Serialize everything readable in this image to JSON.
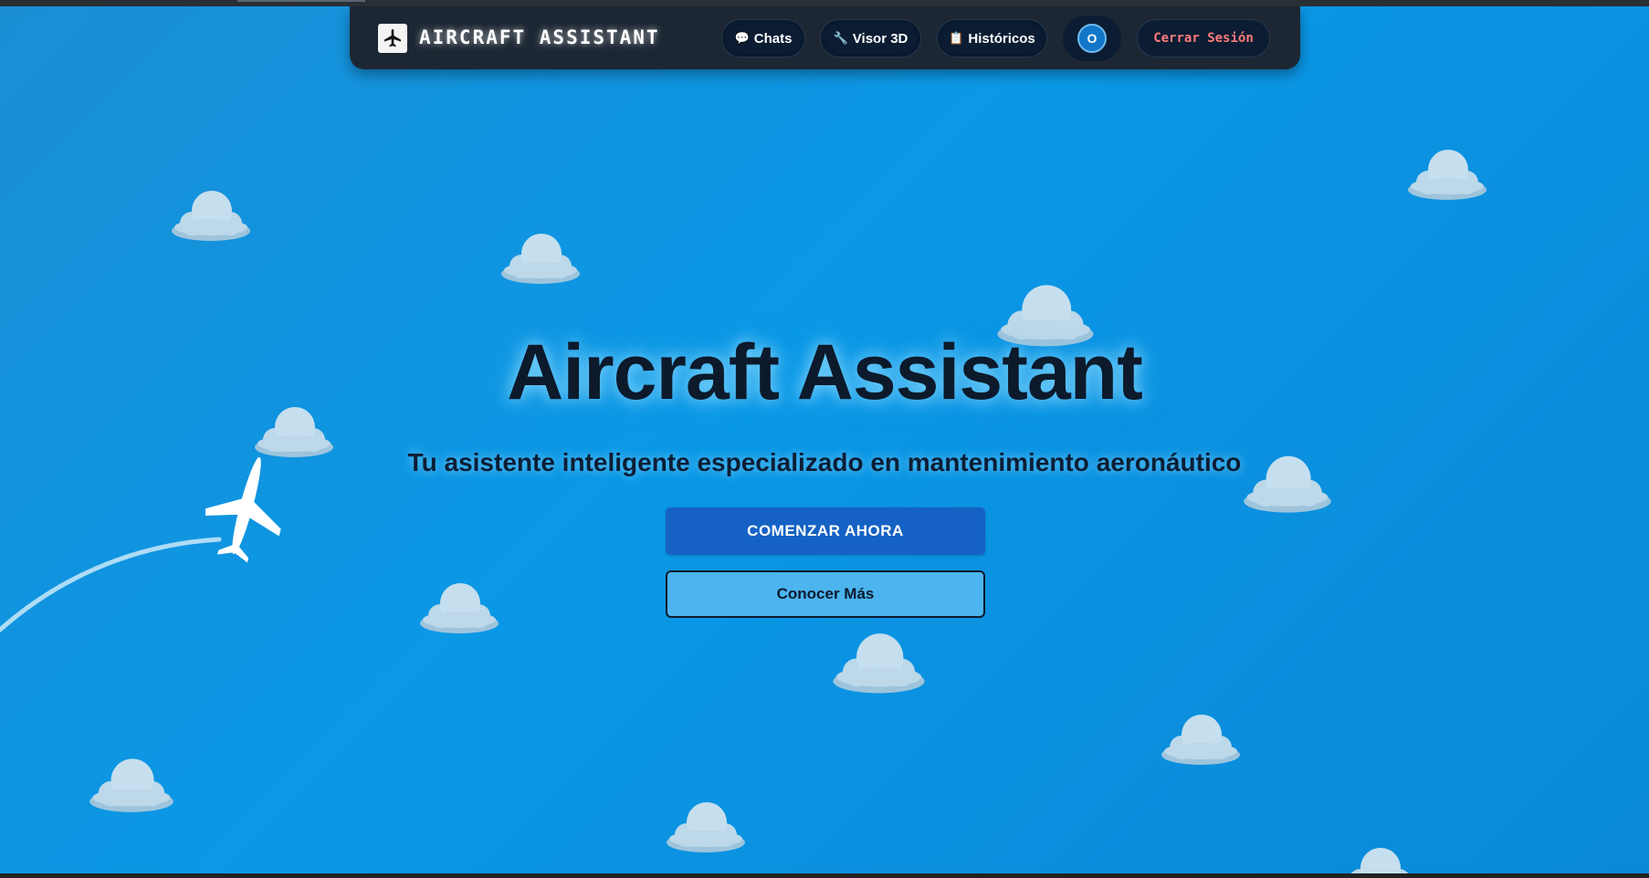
{
  "navbar": {
    "brand_title": "AIRCRAFT ASSISTANT",
    "logo_icon": "airplane-icon",
    "items": [
      {
        "icon": "💬",
        "icon_name": "chat-bubble-icon",
        "label": "Chats"
      },
      {
        "icon": "🔧",
        "icon_name": "wrench-icon",
        "label": "Visor 3D"
      },
      {
        "icon": "📋",
        "icon_name": "clipboard-icon",
        "label": "Históricos"
      }
    ],
    "avatar_initial": "O",
    "logout_label": "Cerrar Sesión"
  },
  "hero": {
    "title": "Aircraft Assistant",
    "subtitle": "Tu asistente inteligente especializado en mantenimiento aeronáutico",
    "primary_button": "COMENZAR AHORA",
    "secondary_button": "Conocer Más"
  },
  "colors": {
    "sky": "#0a98e6",
    "navbar": "#1c2733",
    "primary_button": "#1562c4",
    "secondary_button": "#4cb4ee",
    "logout_text": "#ff7b7b"
  }
}
